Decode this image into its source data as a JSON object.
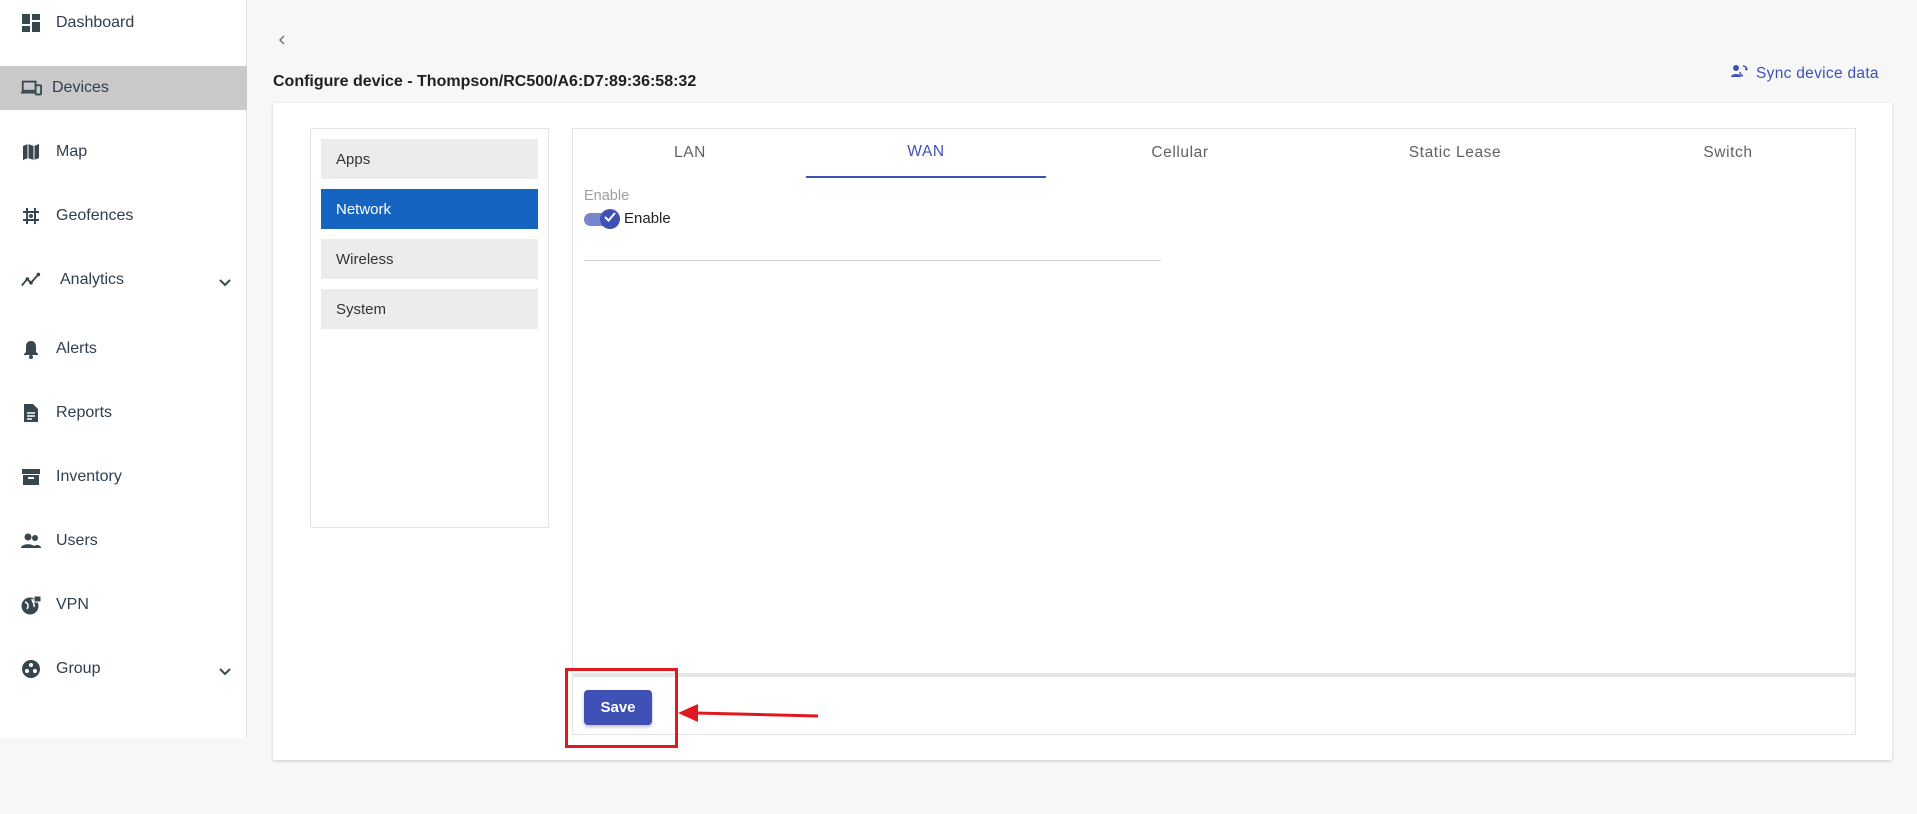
{
  "sidebar": {
    "items": [
      {
        "label": "Dashboard",
        "icon": "dashboard-icon"
      },
      {
        "label": "Devices",
        "icon": "devices-icon",
        "active": true
      },
      {
        "label": "Map",
        "icon": "map-icon"
      },
      {
        "label": "Geofences",
        "icon": "geofence-icon"
      },
      {
        "label": "Analytics",
        "icon": "analytics-icon",
        "expandable": true
      },
      {
        "label": "Alerts",
        "icon": "bell-icon"
      },
      {
        "label": "Reports",
        "icon": "report-icon"
      },
      {
        "label": "Inventory",
        "icon": "archive-icon"
      },
      {
        "label": "Users",
        "icon": "users-icon"
      },
      {
        "label": "VPN",
        "icon": "vpn-globe-icon"
      },
      {
        "label": "Group",
        "icon": "group-icon",
        "expandable": true
      }
    ]
  },
  "header": {
    "title": "Configure device - Thompson/RC500/A6:D7:89:36:58:32",
    "sync_label": "Sync device data"
  },
  "config_menu": {
    "items": [
      {
        "label": "Apps"
      },
      {
        "label": "Network",
        "active": true
      },
      {
        "label": "Wireless"
      },
      {
        "label": "System"
      }
    ]
  },
  "tabs": [
    {
      "label": "LAN"
    },
    {
      "label": "WAN",
      "active": true
    },
    {
      "label": "Cellular"
    },
    {
      "label": "Static Lease"
    },
    {
      "label": "Switch"
    }
  ],
  "form": {
    "enable_field_label": "Enable",
    "enable_toggle_label": "Enable",
    "enable_value": true
  },
  "actions": {
    "save_label": "Save"
  },
  "colors": {
    "primary": "#3f51b5",
    "menu_active": "#1565c0",
    "sidebar_active": "#c9c9c9",
    "annotation": "#e0191f"
  }
}
